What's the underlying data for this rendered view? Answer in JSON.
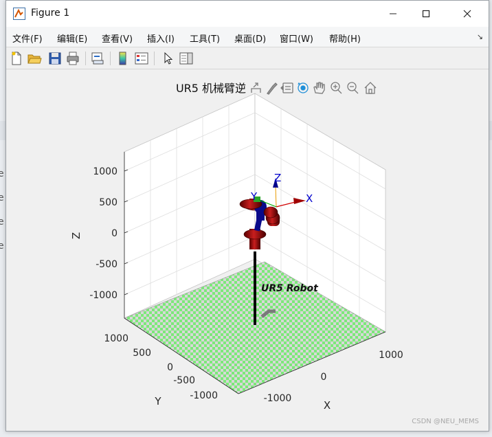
{
  "window": {
    "title": "Figure 1",
    "minimize_glyph": "—",
    "maximize_glyph": "☐",
    "close_glyph": "✕"
  },
  "menu": {
    "items": [
      "文件(F)",
      "编辑(E)",
      "查看(V)",
      "插入(I)",
      "工具(T)",
      "桌面(D)",
      "窗口(W)",
      "帮助(H)"
    ],
    "overflow_glyph": "↘"
  },
  "toolbar": {
    "buttons": [
      "new-figure-icon",
      "open-file-icon",
      "save-icon",
      "print-icon",
      "link-plot-icon",
      "insert-colorbar-icon",
      "insert-legend-icon",
      "edit-plot-arrow-icon",
      "property-inspector-icon"
    ]
  },
  "axes_toolbar": {
    "buttons": [
      "export-icon",
      "brush-icon",
      "data-tips-icon",
      "rotate-3d-icon",
      "pan-icon",
      "zoom-in-icon",
      "zoom-out-icon",
      "home-icon"
    ],
    "active": "rotate-3d-icon"
  },
  "chart_data": {
    "type": "scatter",
    "title": "UR5 机械臂逆",
    "xlabel": "X",
    "ylabel": "Y",
    "zlabel": "Z",
    "z_ticks": [
      "1000",
      "500",
      "0",
      "-500",
      "-1000"
    ],
    "y_ticks": [
      "1000",
      "500",
      "0",
      "-500",
      "-1000"
    ],
    "x_ticks": [
      "1000",
      "0",
      "-1000"
    ],
    "xlim": [
      -1400,
      1400
    ],
    "ylim": [
      -1400,
      1400
    ],
    "zlim": [
      -1400,
      1400
    ],
    "grid": true,
    "annotation": "UR5 Robot",
    "frame_axes": [
      "X",
      "Y",
      "Z"
    ],
    "floor_colors": [
      "#7de87a",
      "#d8d8d8"
    ],
    "link_color": "#8b0000",
    "joint_color": "#00008b"
  },
  "watermark": "CSDN @NEU_MEMS",
  "background": {
    "side_letters": [
      "e",
      "e",
      "e",
      "e"
    ]
  }
}
